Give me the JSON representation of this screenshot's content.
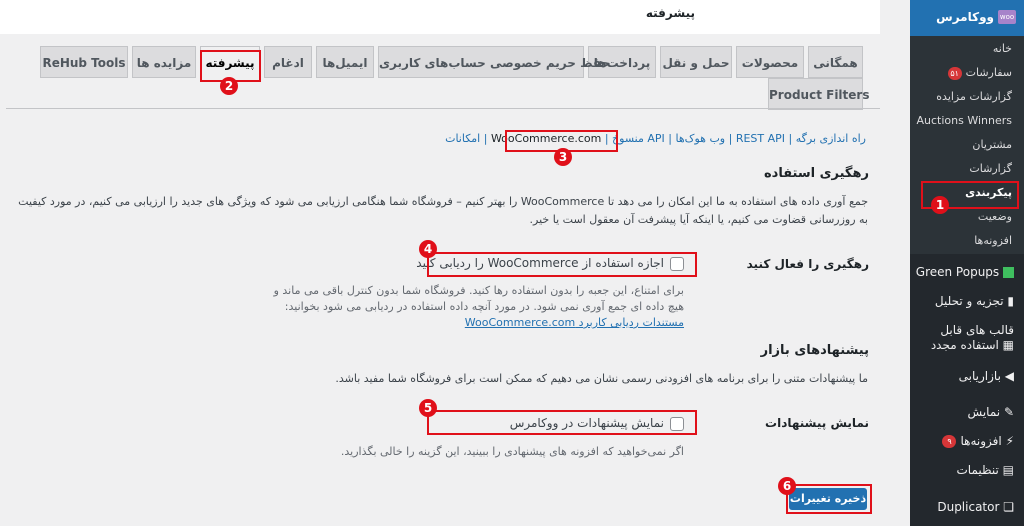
{
  "page_title": "پیشرفته",
  "tabs": [
    {
      "label": "همگانی"
    },
    {
      "label": "محصولات"
    },
    {
      "label": "حمل و نقل"
    },
    {
      "label": "پرداخت‌ها"
    },
    {
      "label": "حفظ حریم خصوصی حساب‌های کاربری"
    },
    {
      "label": "ایمیل‌ها"
    },
    {
      "label": "ادغام"
    },
    {
      "label": "پیشرفته"
    },
    {
      "label": "مزایده ها"
    },
    {
      "label": "ReHub Tools"
    },
    {
      "label": "Product Filters"
    }
  ],
  "subnav": {
    "items": [
      "راه اندازی برگه",
      "REST API",
      "وب هوک‌ها",
      "API منسوخ",
      "WooCommerce.com",
      "امکانات"
    ]
  },
  "sections": {
    "tracking": {
      "title": "رهگیری استفاده",
      "desc": "جمع آوری داده های استفاده به ما این امکان را می دهد تا WooCommerce را بهتر کنیم – فروشگاه شما هنگامی ارزیابی می شود که ویژگی های جدید را ارزیابی می کنیم، در مورد کیفیت به روزرسانی قضاوت می کنیم، یا اینکه آیا پیشرفت آن معقول است یا خیر.",
      "row_label": "رهگیری را فعال کنید",
      "checkbox_label": "اجازه استفاده از WooCommerce را ردیابی کنید",
      "help_text": "برای امتناع، این جعبه را بدون استفاده رها کنید. فروشگاه شما بدون کنترل باقی می ماند و هیچ داده ای جمع آوری نمی شود. در مورد آنچه داده استفاده در ردیابی می شود بخوانید:",
      "help_link": "مستندات ردیابی کاربرد WooCommerce.com"
    },
    "marketplace": {
      "title": "پیشنهادهای بازار",
      "desc": "ما پیشنهادات متنی را برای برنامه های افزودنی رسمی نشان می دهیم که ممکن است برای فروشگاه شما مفید باشد.",
      "row_label": "نمایش پیشنهادات",
      "checkbox_label": "نمایش پیشنهادات در ووکامرس",
      "help_text": "اگر نمی‌خواهید که افزونه های پیشنهادی را ببینید، این گزینه را خالی بگذارید."
    }
  },
  "save_button": "ذخیره تغییرات",
  "sidebar": {
    "top_label": "ووکامرس",
    "woo_badge": "woo",
    "submenu": [
      {
        "label": "خانه"
      },
      {
        "label": "سفارشات",
        "badge": "۵۱"
      },
      {
        "label": "گزارشات مزایده"
      },
      {
        "label": "Auctions Winners"
      },
      {
        "label": "مشتریان"
      },
      {
        "label": "گزارشات"
      },
      {
        "label": "پیکربندی"
      },
      {
        "label": "وضعیت"
      },
      {
        "label": "افزونه‌ها"
      }
    ],
    "menu": [
      {
        "label": "Green Popups",
        "icon": "green-popups-icon"
      },
      {
        "label": "تجزیه و تحلیل",
        "icon": "chart-icon"
      },
      {
        "label": "قالب های قابل استفاده مجدد",
        "icon": "blocks-icon"
      },
      {
        "label": "بازاریابی",
        "icon": "megaphone-icon"
      },
      {
        "label": "نمایش",
        "icon": "brush-icon"
      },
      {
        "label": "افزونه‌ها",
        "icon": "plugin-icon",
        "badge": "۹"
      },
      {
        "label": "تنظیمات",
        "icon": "settings-icon"
      },
      {
        "label": "Duplicator",
        "icon": "duplicator-icon"
      }
    ]
  },
  "callouts": [
    "1",
    "2",
    "3",
    "4",
    "5",
    "6"
  ],
  "colors": {
    "accent": "#2271b1",
    "highlight": "#e0101a",
    "sidebar": "#23282d"
  }
}
